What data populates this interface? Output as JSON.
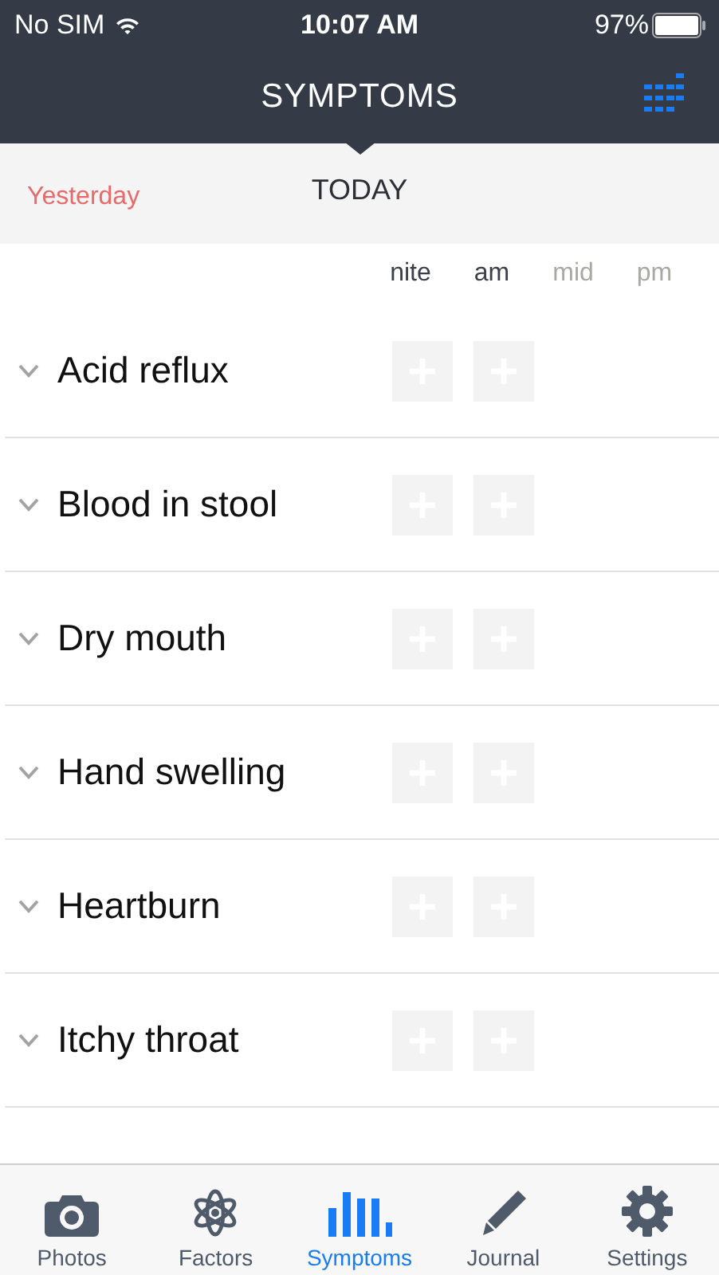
{
  "status_bar": {
    "carrier": "No SIM",
    "time": "10:07 AM",
    "battery": "97%"
  },
  "nav": {
    "title": "SYMPTOMS"
  },
  "date_bar": {
    "previous": "Yesterday",
    "current": "TODAY"
  },
  "columns": [
    {
      "label": "nite",
      "enabled": true
    },
    {
      "label": "am",
      "enabled": true
    },
    {
      "label": "mid",
      "enabled": false
    },
    {
      "label": "pm",
      "enabled": false
    }
  ],
  "symptoms": [
    {
      "name": "Acid reflux",
      "expanded": false
    },
    {
      "name": "Blood in stool",
      "expanded": false
    },
    {
      "name": "Dry mouth",
      "expanded": false
    },
    {
      "name": "Hand swelling",
      "expanded": false
    },
    {
      "name": "Heartburn",
      "expanded": false
    },
    {
      "name": "Itchy throat",
      "expanded": false
    }
  ],
  "tabs": [
    {
      "label": "Photos",
      "selected": false
    },
    {
      "label": "Factors",
      "selected": false
    },
    {
      "label": "Symptoms",
      "selected": true
    },
    {
      "label": "Journal",
      "selected": false
    },
    {
      "label": "Settings",
      "selected": false
    }
  ]
}
